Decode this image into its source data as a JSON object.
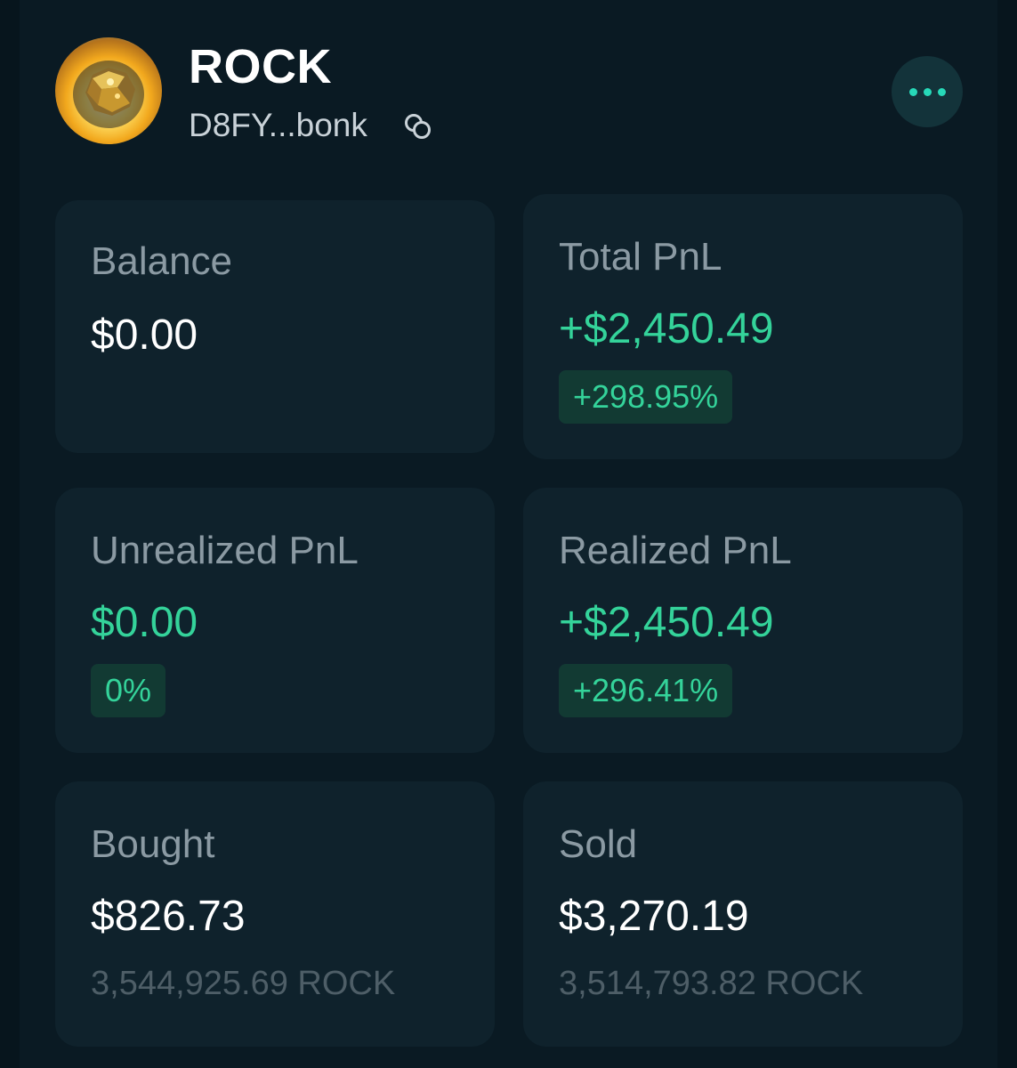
{
  "header": {
    "token_name": "ROCK",
    "address": "D8FY...bonk",
    "copy_icon": "copy-icon",
    "more_icon": "more-icon"
  },
  "colors": {
    "accent": "#27d9b8",
    "positive": "#34d39a",
    "card": "#0f222c",
    "background": "#07151d"
  },
  "stats": {
    "balance": {
      "label": "Balance",
      "value": "$0.00"
    },
    "total_pnl": {
      "label": "Total PnL",
      "value": "+$2,450.49",
      "percent": "+298.95%"
    },
    "unrealized_pnl": {
      "label": "Unrealized PnL",
      "value": "$0.00",
      "percent": "0%"
    },
    "realized_pnl": {
      "label": "Realized PnL",
      "value": "+$2,450.49",
      "percent": "+296.41%"
    },
    "bought": {
      "label": "Bought",
      "value": "$826.73",
      "amount": "3,544,925.69 ROCK"
    },
    "sold": {
      "label": "Sold",
      "value": "$3,270.19",
      "amount": "3,514,793.82 ROCK"
    }
  }
}
